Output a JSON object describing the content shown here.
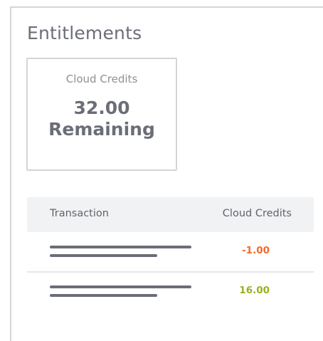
{
  "page": {
    "title": "Entitlements"
  },
  "credits_card": {
    "label": "Cloud Credits",
    "value": "32.00",
    "value_suffix": "Remaining"
  },
  "transactions_table": {
    "columns": [
      "Transaction",
      "Cloud Credits"
    ],
    "rows": [
      {
        "description": "",
        "amount": "-1.00",
        "kind": "debit"
      },
      {
        "description": "",
        "amount": "16.00",
        "kind": "credit"
      }
    ]
  },
  "colors": {
    "debit": "#f26a2b",
    "credit": "#9bb11f",
    "text_primary": "#6b6e78",
    "border": "#d4d5d8"
  }
}
